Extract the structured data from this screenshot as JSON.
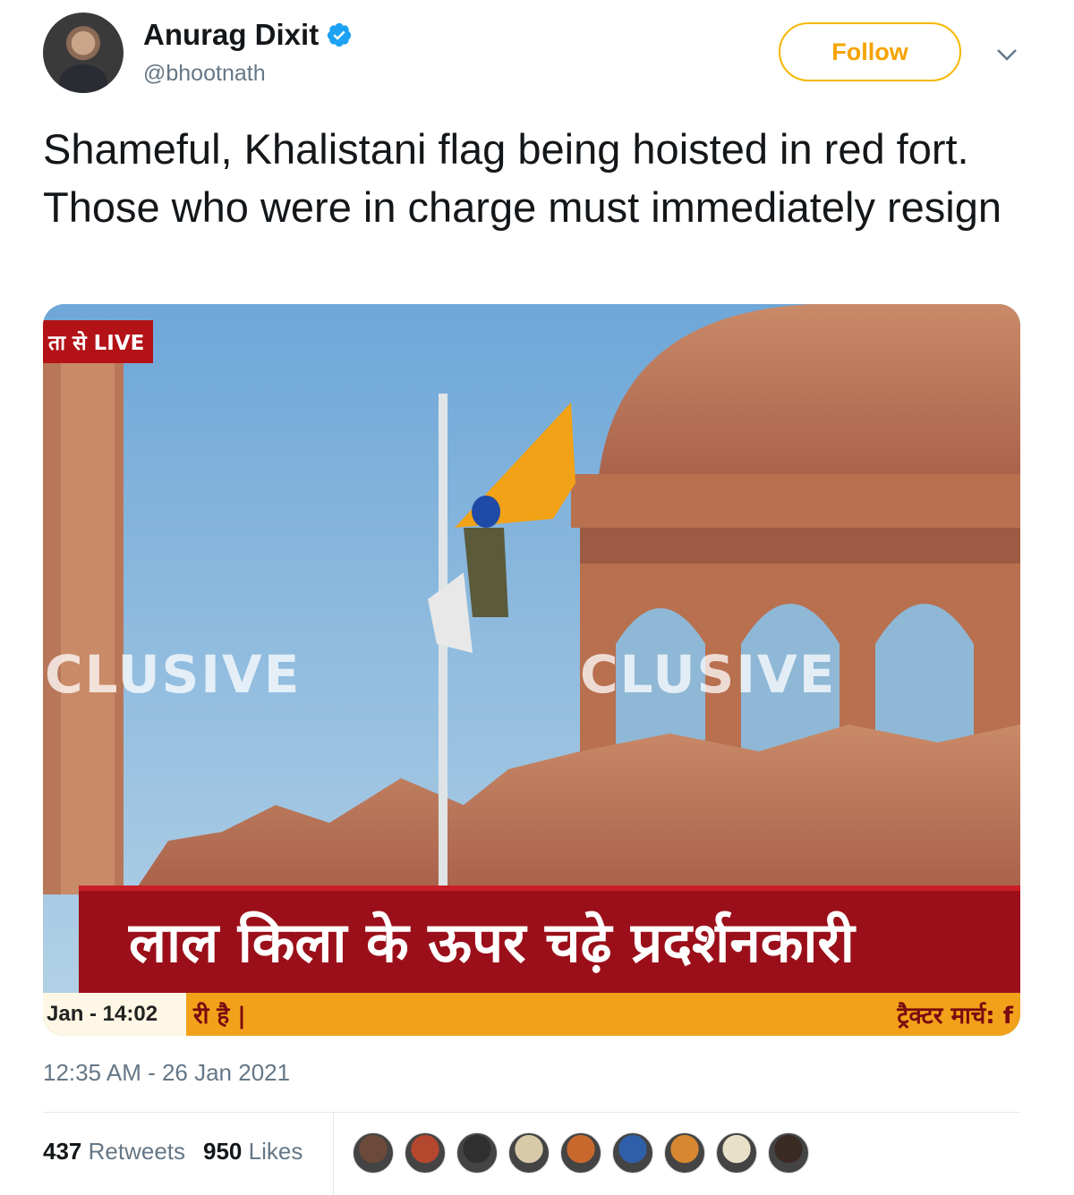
{
  "author": {
    "display_name": "Anurag Dixit",
    "handle": "@bhootnath",
    "verified": true
  },
  "follow_label": "Follow",
  "tweet_text": "Shameful, Khalistani flag being hoisted in red fort. Those who were in charge must immediately resign",
  "media": {
    "live_tag": "ता से LIVE",
    "watermark_left": "CLUSIVE",
    "watermark_mid": "CLUSIVE",
    "headline": "लाल किला के ऊपर चढ़े प्रदर्शनकारी",
    "ticker_time": "Jan - 14:02",
    "ticker_left": "री है |",
    "ticker_right": "ट्रैक्टर मार्च: f"
  },
  "timestamp": "12:35 AM - 26 Jan 2021",
  "stats": {
    "retweets_count": "437",
    "retweets_label": "Retweets",
    "likes_count": "950",
    "likes_label": "Likes"
  },
  "liker_avatars": [
    "#6b4a3a",
    "#b5472f",
    "#2f2f2f",
    "#d8c9a8",
    "#c9682d",
    "#2f5fa8",
    "#d7872f",
    "#e8e0c8",
    "#3a2a24"
  ],
  "colors": {
    "follow_accent": "#f5a300",
    "verified_blue": "#1da1f2",
    "muted_text": "#657786"
  }
}
